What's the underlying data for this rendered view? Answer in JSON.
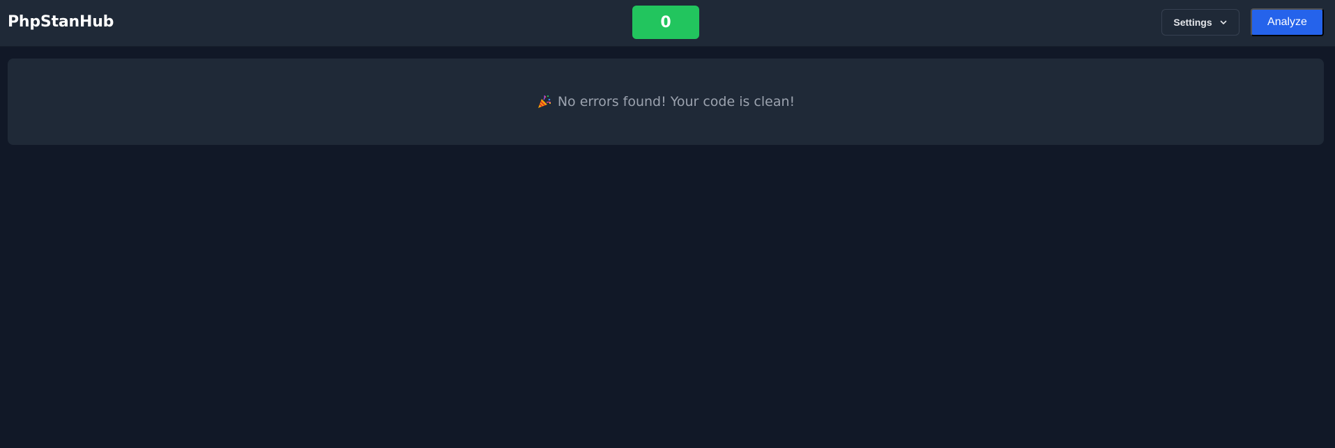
{
  "header": {
    "brand": "PhpStanHub",
    "error_count": "0",
    "settings_label": "Settings",
    "analyze_label": "Analyze"
  },
  "result": {
    "icon": "party-popper-icon",
    "message": "No errors found! Your code is clean!"
  },
  "colors": {
    "background": "#111827",
    "panel": "#1f2937",
    "success": "#22c55e",
    "primary": "#2563eb",
    "muted_text": "#9ca3af"
  }
}
